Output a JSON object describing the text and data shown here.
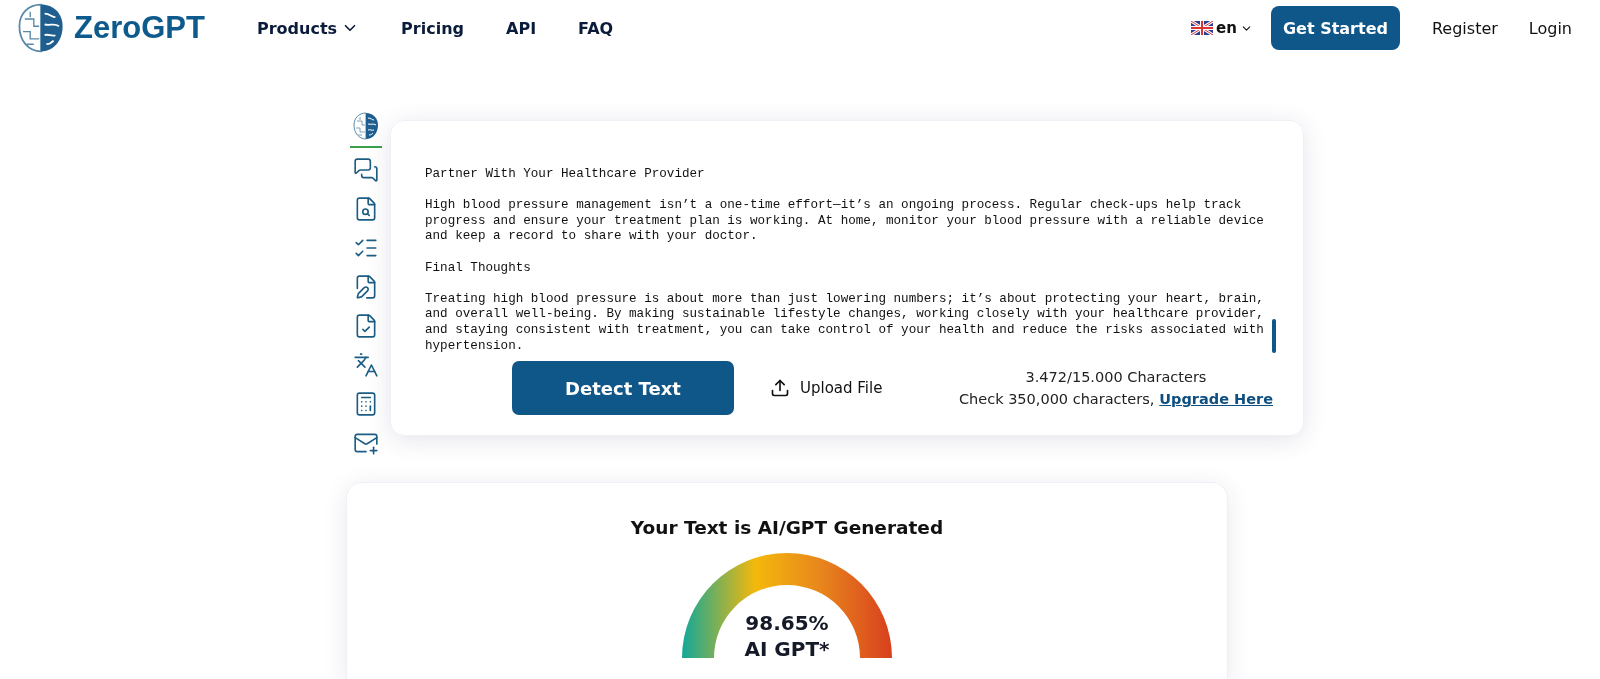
{
  "header": {
    "logo": "ZeroGPT",
    "nav": [
      {
        "label": "Products",
        "kind": "dropdown"
      },
      {
        "label": "Pricing",
        "kind": "link"
      },
      {
        "label": "API",
        "kind": "link"
      },
      {
        "label": "FAQ",
        "kind": "link"
      }
    ],
    "language": "en",
    "cta": "Get Started",
    "links": [
      "Register",
      "Login"
    ]
  },
  "tools": [
    {
      "selected": true
    },
    {
      "selected": false
    },
    {
      "selected": false
    },
    {
      "selected": false
    },
    {
      "selected": false
    },
    {
      "selected": false
    },
    {
      "selected": false
    },
    {
      "selected": false
    },
    {
      "selected": false
    }
  ],
  "editor": {
    "paragraphs": [
      "Partner With Your Healthcare Provider",
      "High blood pressure management isn’t a one-time effort—it’s an ongoing process. Regular check-ups help track progress and ensure your treatment plan is working. At home, monitor your blood pressure with a reliable device and keep a record to share with your doctor.",
      "Final Thoughts",
      "Treating high blood pressure is about more than just lowering numbers; it’s about protecting your heart, brain, and overall well-being. By making sustainable lifestyle changes, working closely with your healthcare provider, and staying consistent with treatment, you can take control of your health and reduce the risks associated with hypertension."
    ],
    "detect_button": "Detect Text",
    "upload_button": "Upload File",
    "count": "3.472/15.000 Characters",
    "upgrade_note": "Check 350,000 characters,",
    "upgrade_link": "Upgrade Here"
  },
  "result": {
    "title": "Your Text is AI/GPT Generated",
    "score": "98.65%",
    "score_label": "AI GPT*"
  }
}
